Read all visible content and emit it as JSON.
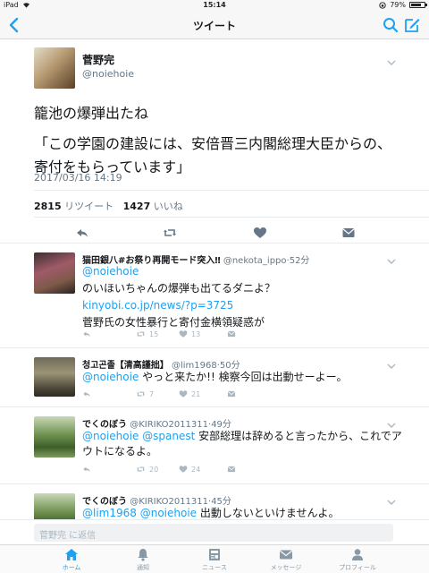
{
  "status": {
    "device": "iPad",
    "time": "15:14",
    "battery": "79%",
    "battery_level": 0.79
  },
  "nav": {
    "title": "ツイート"
  },
  "tweet": {
    "name": "菅野完",
    "handle": "@noiehoie",
    "line1": "籠池の爆弾出たね",
    "line2": "「この学園の建設には、安倍晋三内閣総理大臣からの、寄付をもらっています」",
    "time": "2017/03/16 14:19",
    "retweets": "2815",
    "retweets_label": "リツイート",
    "likes": "1427",
    "likes_label": "いいね"
  },
  "replies": [
    {
      "name": "猫田銀八#お祭り再開モード突入‼",
      "handle": "@nekota_ippo",
      "age": "·52分",
      "mention": "@noiehoie",
      "text1": "のいほいちゃんの爆弾も出てるダニよ？",
      "link": "kinyobi.co.jp/news/?p=3725",
      "text2": "菅野氏の女性暴行と寄付金横領疑惑が",
      "rt": "15",
      "like": "13"
    },
    {
      "name": "청고곤졸【清高謹拙】",
      "handle": "@lim1968",
      "age": "·50分",
      "mention": "@noiehoie",
      "text1": " やっと来たか!! 検察今回は出動せーよー。",
      "rt": "7",
      "like": "21"
    },
    {
      "name": "でくのぼう",
      "handle": "@KIRIKO2011311",
      "age": "·49分",
      "mention": "@noiehoie @spanest",
      "text1": " 安部総理は辞めると言ったから、これでアウトになるよ。",
      "rt": "20",
      "like": "24"
    },
    {
      "name": "でくのぼう",
      "handle": "@KIRIKO2011311",
      "age": "·45分",
      "mention": "@lim1968 @noiehoie",
      "text1": " 出動しないといけませんよ。"
    }
  ],
  "reply_placeholder": "菅野完 に返信",
  "tabs": [
    {
      "label": "ホーム",
      "icon": "home-icon"
    },
    {
      "label": "通知",
      "icon": "bell-icon"
    },
    {
      "label": "ニュース",
      "icon": "news-icon"
    },
    {
      "label": "メッセージ",
      "icon": "envelope-icon"
    },
    {
      "label": "プロフィール",
      "icon": "person-icon"
    }
  ],
  "colors": {
    "accent": "#1da1f2",
    "muted": "#657786",
    "icon_gray": "#657786"
  }
}
